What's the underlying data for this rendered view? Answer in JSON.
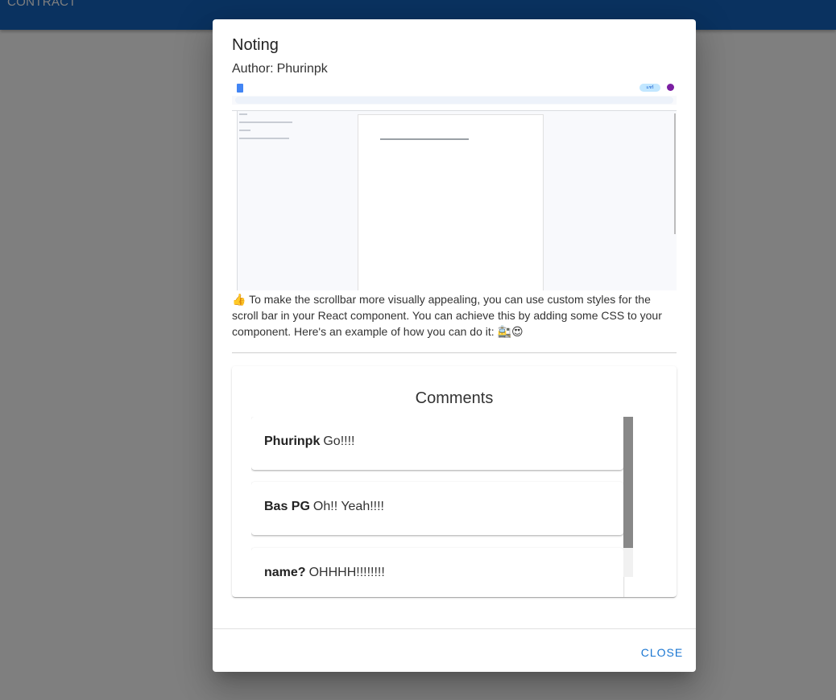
{
  "appbar": {
    "title": "CONTRACT"
  },
  "dialog": {
    "title": "Noting",
    "author_label": "Author:",
    "author": "Phurinpk",
    "body": "👍 To make the scrollbar more visually appealing, you can use custom styles for the scroll bar in your React component. You can achieve this by adding some CSS to your component. Here's an example of how you can do it: 🚉😍",
    "close_label": "CLOSE"
  },
  "image": {
    "share_label": "แชร์"
  },
  "comments": {
    "title": "Comments",
    "items": [
      {
        "author": "Phurinpk",
        "text": "Go!!!!"
      },
      {
        "author": "Bas PG",
        "text": "Oh!! Yeah!!!!"
      },
      {
        "author": "name?",
        "text": "OHHHH!!!!!!!!"
      }
    ]
  },
  "colors": {
    "appbar": "#1565c0",
    "accent": "#1976d2",
    "scroll_thumb": "#888888",
    "scroll_track": "#f1f1f1"
  }
}
